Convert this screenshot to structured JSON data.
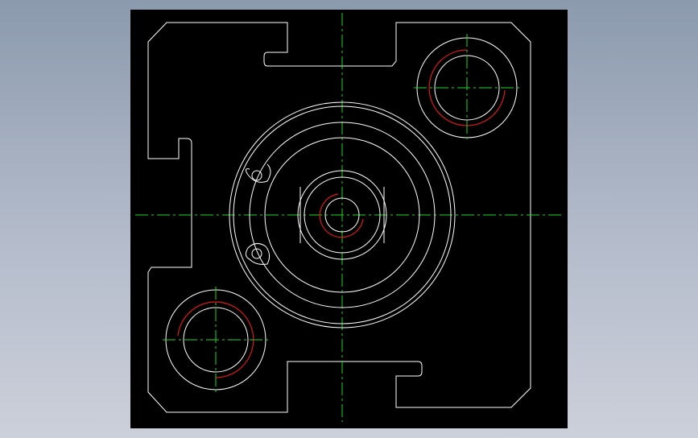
{
  "view": {
    "background": "#000000",
    "outline_color": "#ffffff",
    "centerline_color": "#1ed81e",
    "thread_color": "#e01818"
  }
}
